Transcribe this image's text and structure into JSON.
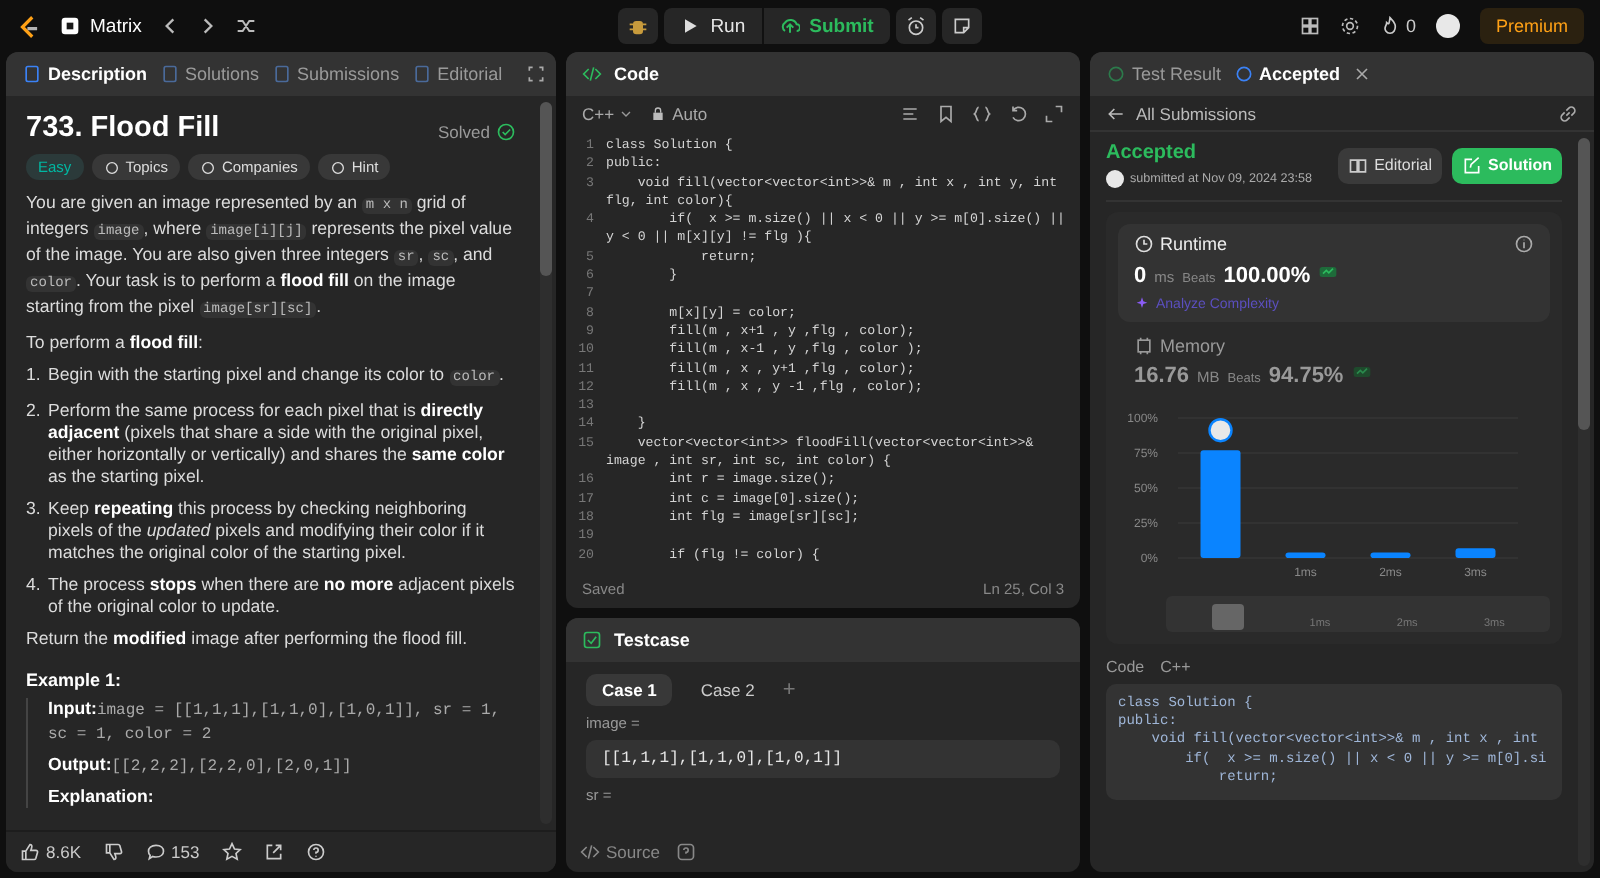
{
  "topbar": {
    "problem_list": "Matrix",
    "run": "Run",
    "submit": "Submit",
    "streak": "0",
    "premium": "Premium"
  },
  "description_panel": {
    "tabs": [
      {
        "label": "Description",
        "selected": true
      },
      {
        "label": "Solutions",
        "selected": false
      },
      {
        "label": "Submissions",
        "selected": false
      },
      {
        "label": "Editorial",
        "selected": false
      }
    ],
    "title": "733. Flood Fill",
    "status": "Solved",
    "difficulty": "Easy",
    "tags": [
      "Topics",
      "Companies",
      "Hint"
    ],
    "intro": [
      {
        "kind": "text",
        "text": "You are given an image represented by an "
      },
      {
        "kind": "code",
        "text": "m x n"
      },
      {
        "kind": "text",
        "text": " grid of integers "
      },
      {
        "kind": "code",
        "text": "image"
      },
      {
        "kind": "text",
        "text": ", where "
      },
      {
        "kind": "code",
        "text": "image[i][j]"
      },
      {
        "kind": "text",
        "text": " represents the pixel value of the image. You are also given three integers "
      },
      {
        "kind": "code",
        "text": "sr"
      },
      {
        "kind": "text",
        "text": ", "
      },
      {
        "kind": "code",
        "text": "sc"
      },
      {
        "kind": "text",
        "text": ", and "
      },
      {
        "kind": "code",
        "text": "color"
      },
      {
        "kind": "text",
        "text": ". Your task is to perform a "
      },
      {
        "kind": "bold",
        "text": "flood fill"
      },
      {
        "kind": "text",
        "text": " on the image starting from the pixel "
      },
      {
        "kind": "code",
        "text": "image[sr][sc]"
      },
      {
        "kind": "text",
        "text": "."
      }
    ],
    "steps_intro": [
      {
        "kind": "text",
        "text": "To perform a "
      },
      {
        "kind": "bold",
        "text": "flood fill"
      },
      {
        "kind": "text",
        "text": ":"
      }
    ],
    "steps": [
      {
        "number": "1.",
        "text": [
          {
            "kind": "text",
            "text": "Begin with the starting pixel and change its color to "
          },
          {
            "kind": "code",
            "text": "color"
          },
          {
            "kind": "text",
            "text": "."
          }
        ]
      },
      {
        "number": "2.",
        "text": [
          {
            "kind": "text",
            "text": "Perform the same process for each pixel that is "
          },
          {
            "kind": "bold",
            "text": "directly adjacent"
          },
          {
            "kind": "text",
            "text": " (pixels that share a side with the original pixel, either horizontally or vertically) and shares the "
          },
          {
            "kind": "bold",
            "text": "same color"
          },
          {
            "kind": "text",
            "text": " as the starting pixel."
          }
        ]
      },
      {
        "number": "3.",
        "text": [
          {
            "kind": "text",
            "text": "Keep "
          },
          {
            "kind": "bold",
            "text": "repeating"
          },
          {
            "kind": "text",
            "text": " this process by checking neighboring pixels of the "
          },
          {
            "kind": "italic",
            "text": "updated"
          },
          {
            "kind": "text",
            "text": " pixels and modifying their color if it matches the original color of the starting pixel."
          }
        ]
      },
      {
        "number": "4.",
        "text": [
          {
            "kind": "text",
            "text": "The process "
          },
          {
            "kind": "bold",
            "text": "stops"
          },
          {
            "kind": "text",
            "text": " when there are "
          },
          {
            "kind": "bold",
            "text": "no more"
          },
          {
            "kind": "text",
            "text": " adjacent pixels of the original color to update."
          }
        ]
      }
    ],
    "closing": [
      {
        "kind": "text",
        "text": "Return the "
      },
      {
        "kind": "bold",
        "text": "modified"
      },
      {
        "kind": "text",
        "text": " image after performing the flood fill."
      }
    ],
    "example": {
      "title": "Example 1:",
      "lines": [
        {
          "label": "Input:",
          "value": "image = [[1,1,1],[1,1,0],[1,0,1]], sr = 1, sc = 1, color = 2"
        },
        {
          "label": "Output:",
          "value": "[[2,2,2],[2,2,0],[2,0,1]]"
        },
        {
          "label": "Explanation:"
        }
      ]
    },
    "footer": {
      "likes": "8.6K",
      "comments": "153"
    }
  },
  "code_panel": {
    "title": "Code",
    "language": "C++",
    "mode": "Auto",
    "lines": [
      {
        "number": "1",
        "text": "class Solution {"
      },
      {
        "number": "2",
        "text": "public:"
      },
      {
        "number": "3",
        "text": "    void fill(vector<vector<int>>& m , int x , int y, int flg, int color){"
      },
      {
        "number": "4",
        "text": "        if(  x >= m.size() || x < 0 || y >= m[0].size() || y < 0 || m[x][y] != flg ){"
      },
      {
        "number": "5",
        "text": "            return;"
      },
      {
        "number": "6",
        "text": "        }"
      },
      {
        "number": "7"
      },
      {
        "number": "8",
        "text": "        m[x][y] = color;"
      },
      {
        "number": "9",
        "text": "        fill(m , x+1 , y ,flg , color);"
      },
      {
        "number": "10",
        "text": "        fill(m , x-1 , y ,flg , color );"
      },
      {
        "number": "11",
        "text": "        fill(m , x , y+1 ,flg , color);"
      },
      {
        "number": "12",
        "text": "        fill(m , x , y -1 ,flg , color);"
      },
      {
        "number": "13"
      },
      {
        "number": "14",
        "text": "    }"
      },
      {
        "number": "15",
        "text": "    vector<vector<int>> floodFill(vector<vector<int>>& image , int sr, int sc, int color) {"
      },
      {
        "number": "16",
        "text": "        int r = image.size();"
      },
      {
        "number": "17",
        "text": "        int c = image[0].size();"
      },
      {
        "number": "18",
        "text": "        int flg = image[sr][sc];"
      },
      {
        "number": "19"
      },
      {
        "number": "20",
        "text": "        if (flg != color) {"
      }
    ],
    "status": "Saved",
    "cursor": "Ln 25, Col 3"
  },
  "testcase_panel": {
    "title": "Testcase",
    "cases": [
      {
        "label": "Case 1",
        "selected": true
      },
      {
        "label": "Case 2",
        "selected": false
      }
    ],
    "add": "+",
    "fields": [
      {
        "label": "image =",
        "value": "[[1,1,1],[1,1,0],[1,0,1]]"
      },
      {
        "label": "sr ="
      }
    ],
    "source": "Source"
  },
  "result_panel": {
    "tabs": [
      {
        "label": "Test Result",
        "selected": false
      },
      {
        "label": "Accepted",
        "selected": true
      }
    ],
    "back": "All Submissions",
    "status": "Accepted",
    "submitted": "submitted at Nov 09, 2024 23:58",
    "editorial_button": "Editorial",
    "solution_button": "Solution",
    "runtime": {
      "title": "Runtime",
      "value": "0",
      "unit": "ms",
      "beats_label": "Beats",
      "beats": "100.00%",
      "analyze": "Analyze Complexity"
    },
    "memory": {
      "title": "Memory",
      "value": "16.76",
      "unit": "MB",
      "beats_label": "Beats",
      "beats": "94.75%"
    },
    "chart_data": {
      "type": "bar",
      "grid": true,
      "categories": [
        null,
        "1ms",
        "2ms",
        "3ms"
      ],
      "values": [
        77,
        4,
        4,
        7
      ],
      "ylim": [
        0,
        100
      ],
      "yticks": [
        {
          "value": 0,
          "label": "0%"
        },
        {
          "value": 25,
          "label": "25%"
        },
        {
          "value": 50,
          "label": "50%"
        },
        {
          "value": 75,
          "label": "75%"
        },
        {
          "value": 100,
          "label": "100%"
        }
      ]
    },
    "overview_labels": [
      "1ms",
      "2ms",
      "3ms"
    ],
    "code_label": "Code",
    "code_language": "C++",
    "code_lines": [
      "class Solution {",
      "public:",
      "    void fill(vector<vector<int>>& m , int x , int",
      "        if(  x >= m.size() || x < 0 || y >= m[0].si",
      "            return;"
    ]
  }
}
